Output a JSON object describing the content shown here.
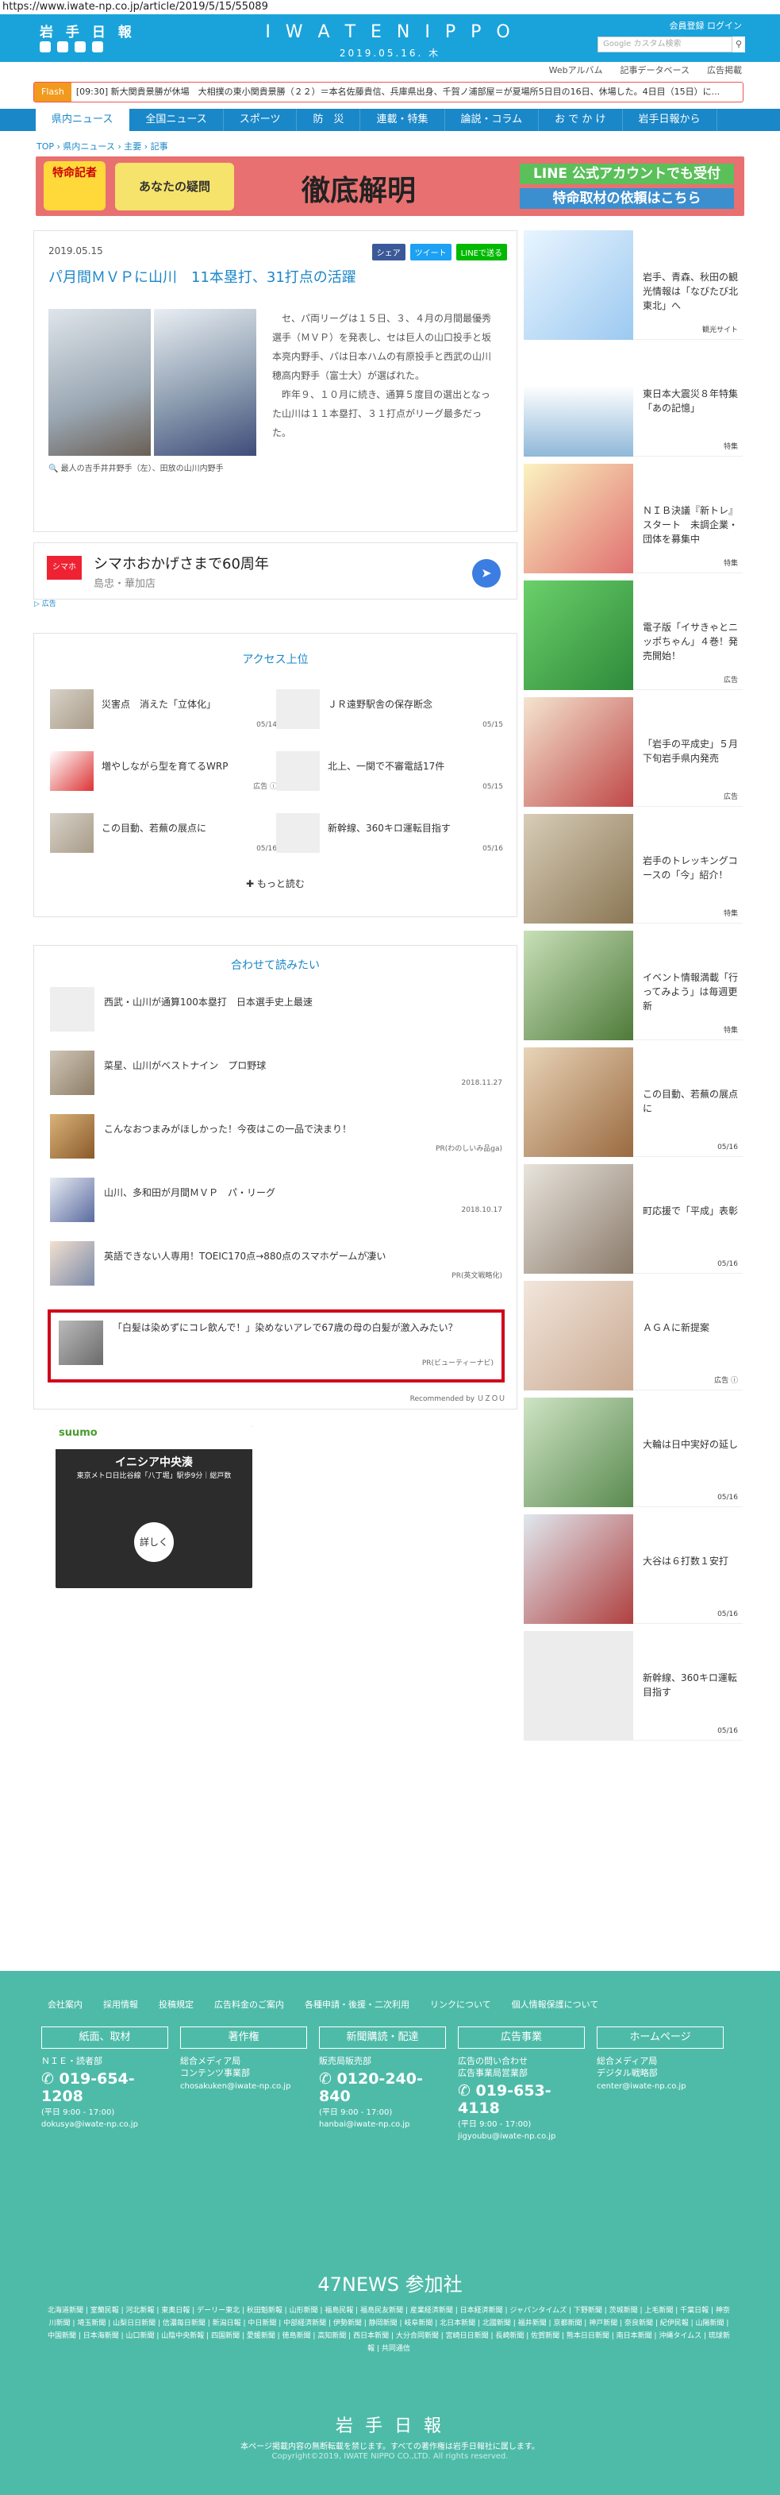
{
  "url": "https://www.iwate-np.co.jp/article/2019/5/15/55089",
  "header": {
    "logo": "岩 手 日 報",
    "center_logo": "I W A T E  N I P P O",
    "date": "2019.05.16. 木",
    "top_links": "会員登録  ログイン",
    "search_placeholder": "Google カスタム検索",
    "sub_links": [
      "Webアルバム",
      "記事データベース",
      "広告掲載"
    ]
  },
  "flash": {
    "tag": "Flash",
    "text": "[09:30] 新大関貴景勝が休場　大相撲の東小関貴景勝（２２）＝本名佐藤貴信、兵庫県出身、千賀ノ浦部屋＝が夏場所5日目の16日、休場した。4日目（15日）に..."
  },
  "nav": [
    "県内ニュース",
    "全国ニュース",
    "スポーツ",
    "防　災",
    "連載・特集",
    "論説・コラム",
    "お で か け",
    "岩手日報から"
  ],
  "breadcrumb": "TOP › 県内ニュース › 主要 › 記事",
  "banner": {
    "b1": "特命記者",
    "b2": "あなたの疑問",
    "b3": "徹底解明",
    "b4": "LINE 公式アカウントでも受付",
    "b5": "特命取材の依頼はこちら"
  },
  "article": {
    "date": "2019.05.15",
    "share": [
      "シェア",
      "ツイート",
      "LINEで送る"
    ],
    "title": "パ月間ＭＶＰに山川　11本塁打、31打点の活躍",
    "caption": "🔍 最人の吉手井井野手（左）、田放の山川内野手",
    "body": "　セ、パ両リーグは１５日、３、４月の月間最優秀選手（ＭＶＰ）を発表し、セは巨人の山口投手と坂本亮内野手、パは日本ハムの有原投手と西武の山川穂高内野手（富士大）が選ばれた。\n　昨年９、１０月に続き、通算５度目の選出となった山川は１１本塁打、３１打点がリーグ最多だった。"
  },
  "ad": {
    "logo": "シマホ",
    "title": "シマホおかげさまで60周年",
    "subtitle": "島忠・華加店",
    "tag": "▷ 広告"
  },
  "ranking": {
    "title": "アクセス上位",
    "items": [
      {
        "title": "災害点　消えた「立体化」",
        "date": "05/14"
      },
      {
        "title": "ＪＲ遠野駅舎の保存断念",
        "date": "05/15"
      },
      {
        "title": "増やしながら型を育てるWRP",
        "date": "広告 ⓘ"
      },
      {
        "title": "北上、一関で不審電話17件",
        "date": "05/15"
      },
      {
        "title": "この目動、若蕪の展点に",
        "date": "05/16"
      },
      {
        "title": "新幹線、360キロ運転目指す",
        "date": "05/16"
      }
    ],
    "more": "もっと読む"
  },
  "related": {
    "title": "合わせて読みたい",
    "items": [
      {
        "title": "西武・山川が通算100本塁打　日本選手史上最速",
        "src": ""
      },
      {
        "title": "菜星、山川がベストナイン　プロ野球",
        "src": "2018.11.27"
      },
      {
        "title": "こんなおつまみがほしかった！今夜はこの一品で決まり！",
        "src": "PR(わのしいみ品ga)"
      },
      {
        "title": "山川、多和田が月間ＭＶＰ　パ・リーグ",
        "src": "2018.10.17"
      },
      {
        "title": "英語できない人専用！TOEIC170点→880点のスマホゲームが凄い",
        "src": "PR(英文戦略化)"
      },
      {
        "title": "「白髪は染めずにコレ飲んで！」染めないアレで67歳の母の白髪が激入みたい？",
        "src": "PR(ビューティーナビ)"
      }
    ],
    "recommended": "Recommended by ＵＺＯＵ"
  },
  "suumo": {
    "brand": "suumo",
    "title": "イニシア中央湊",
    "subtitle": "東京メトロ日比谷線「八丁堀」駅歩9分｜総戸数",
    "button": "詳しく"
  },
  "sidebar": [
    {
      "title": "岩手、青森、秋田の観光情報は「なびたび北東北」へ",
      "tag": "観光サイト"
    },
    {
      "title": "東日本大震災８年特集「あの記憶」",
      "tag": "特集"
    },
    {
      "title": "ＮＩＢ決議『新トレ』スタート　未調企業・団体を募集中",
      "tag": "特集"
    },
    {
      "title": "電子版「イサきゃとニッポちゃん」４巻！発売開始！",
      "tag": "広告"
    },
    {
      "title": "「岩手の平成史」５月下旬岩手県内発売",
      "tag": "広告"
    },
    {
      "title": "岩手のトレッキングコースの「今」紹介！",
      "tag": "特集"
    },
    {
      "title": "イベント情報満載「行ってみよう」は毎週更新",
      "tag": "特集"
    },
    {
      "title": "この目動、若蕪の展点に",
      "tag": "05/16"
    },
    {
      "title": "町応援で「平成」表彰",
      "tag": "05/16"
    },
    {
      "title": "ＡＧＡに新提案",
      "tag": "広告 ⓘ"
    },
    {
      "title": "大輪は日中実好の延し",
      "tag": "05/16"
    },
    {
      "title": "大谷は６打数１安打",
      "tag": "05/16"
    },
    {
      "title": "新幹線、360キロ運転目指す",
      "tag": "05/16"
    }
  ],
  "footer": {
    "links": [
      "会社案内",
      "採用情報",
      "投稿規定",
      "広告料金のご案内",
      "各種申請・後援・二次利用",
      "リンクについて",
      "個人情報保護について"
    ],
    "cols": [
      {
        "box": "紙面、取材",
        "sub": "ＮＩＥ・読者部",
        "phone": "019-654-1208",
        "hours": "(平日 9:00 - 17:00)",
        "mail": "dokusya@iwate-np.co.jp"
      },
      {
        "box": "著作権",
        "sub": "総合メディア局\nコンテンツ事業部",
        "phone": "",
        "hours": "",
        "mail": "chosakuken@iwate-np.co.jp"
      },
      {
        "box": "新聞購読・配達",
        "sub": "販売局販売部",
        "phone": "0120-240-840",
        "hours": "(平日 9:00 - 17:00)",
        "mail": "hanbai@iwate-np.co.jp"
      },
      {
        "box": "広告事業",
        "sub": "広告の問い合わせ\n広告事業局営業部",
        "phone": "019-653-4118",
        "hours": "(平日 9:00 - 17:00)",
        "mail": "jigyoubu@iwate-np.co.jp"
      },
      {
        "box": "ホームページ",
        "sub": "総合メディア局\nデジタル戦略部",
        "phone": "",
        "hours": "",
        "mail": "center@iwate-np.co.jp"
      }
    ],
    "title47": "47NEWS 参加社",
    "papers": "北海道新聞 | 室蘭民報 | 河北新報 | 東奥日報 | デーリー東北 | 秋田魁新報 | 山形新聞 | 福島民報 | 福島民友新聞 | 産業経済新聞 | 日本経済新聞 | ジャパンタイムズ | 下野新聞 | 茨城新聞 | 上毛新聞 | 千葉日報 | 神奈川新聞 | 埼玉新聞 | 山梨日日新聞 | 信濃毎日新聞 | 新潟日報 | 中日新聞 | 中部経済新聞 | 伊勢新聞 | 静岡新聞 | 岐阜新聞 | 北日本新聞 | 北國新聞 | 福井新聞 | 京都新聞 | 神戸新聞 | 奈良新聞 | 紀伊民報 | 山陽新聞 | 中国新聞 | 日本海新聞 | 山口新聞 | 山陰中央新報 | 四国新聞 | 愛媛新聞 | 徳島新聞 | 高知新聞 | 西日本新聞 | 大分合同新聞 | 宮崎日日新聞 | 長崎新聞 | 佐賀新聞 | 熊本日日新聞 | 南日本新聞 | 沖縄タイムス | 琉球新報 | 共同通信",
    "logo": "岩 手 日 報",
    "copy": "本ページ掲載内容の無断転載を禁じます。すべての著作権は岩手日報社に属します。",
    "copy2": "Copyright©2019, IWATE NIPPO CO.,LTD. All rights reserved."
  }
}
